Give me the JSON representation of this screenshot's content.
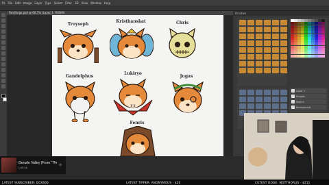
{
  "menu": [
    "Ps",
    "File",
    "Edit",
    "Image",
    "Layer",
    "Type",
    "Select",
    "Filter",
    "3D",
    "View",
    "Window",
    "Help"
  ],
  "document_tab": "Fanthings.psd @ 66.7% (Layer 1, RGB/8)",
  "emotes": [
    {
      "name": "Troyseph"
    },
    {
      "name": "Kristhanskat"
    },
    {
      "name": "Chris"
    },
    {
      "name": "Gandolphus"
    },
    {
      "name": "Lukiryo"
    },
    {
      "name": "Jugas"
    },
    {
      "name": "Fenris"
    }
  ],
  "panels": {
    "brushes_title": "Brushes",
    "layers": [
      "Layer 1",
      "Shapes",
      "Sketch",
      "Background"
    ]
  },
  "now_playing": {
    "title": "Gerudo Valley (From \"The",
    "artist": "Lofi Lia"
  },
  "ticker": {
    "subscriber": "LATEST SUBSCRIBER: DCK666",
    "tipper": "LATEST TIPPER: ANONYMOUS - $20",
    "cutest": "CUTEST DOGE: MOTTHORUS - $211"
  },
  "colors": {
    "fur": "#e58a3a",
    "fur_light": "#fbe3c6",
    "outline": "#2a1a10",
    "accent_blue": "#6fb5d8",
    "accent_red": "#c9322a",
    "accent_green": "#3c8a3a",
    "skull": "#e6df9a"
  }
}
